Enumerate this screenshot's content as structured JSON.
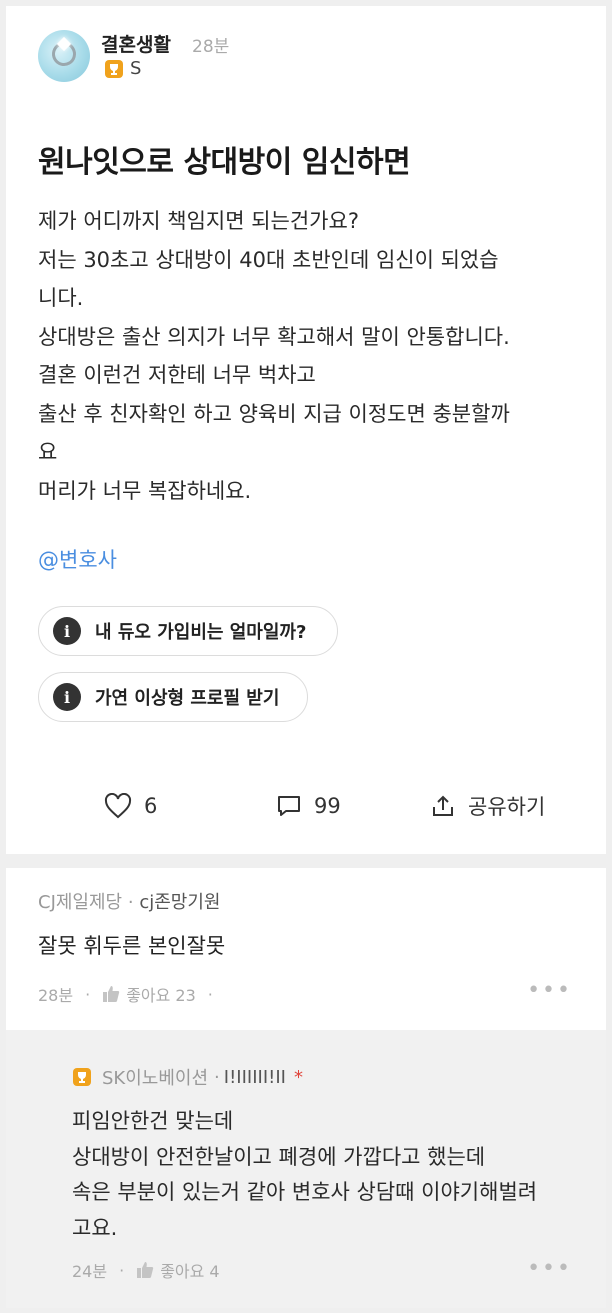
{
  "post": {
    "author": "결혼생활",
    "time": "28분",
    "grade": "S",
    "title": "원나잇으로 상대방이 임신하면",
    "body_lines": [
      "제가 어디까지 책임지면 되는건가요?",
      "저는 30초고 상대방이 40대 초반인데 임신이 되었습",
      "니다.",
      "상대방은 출산 의지가 너무 확고해서 말이 안통합니다.",
      "결혼 이런건 저한테 너무 벅차고",
      "출산 후 친자확인 하고 양육비 지급 이정도면 충분할까",
      "요",
      "머리가 너무 복잡하네요."
    ],
    "mention": "@변호사",
    "chips": [
      "내 듀오 가입비는 얼마일까?",
      "가연 이상형 프로필 받기"
    ],
    "info_glyph": "i",
    "likes": "6",
    "comments": "99",
    "share_label": "공유하기"
  },
  "comment": {
    "company": "CJ제일제당",
    "separator": "·",
    "nickname": "cj존망기원",
    "text": "잘못 휘두른 본인잘못",
    "time": "28분",
    "like_label": "좋아요 23",
    "more": "•••"
  },
  "reply": {
    "company": "SK이노베이션",
    "separator": "·",
    "nickname": "I!IIIIII!II",
    "author_mark": "*",
    "lines": [
      "피임안한건 맞는데",
      "상대방이 안전한날이고 폐경에 가깝다고 했는데",
      "속은 부분이 있는거 같아 변호사 상담때 이야기해벌려",
      "고요."
    ],
    "time": "24분",
    "like_label": "좋아요 4",
    "more": "•••"
  },
  "colors": {
    "accent_link": "#4a8ee0",
    "trophy": "#f0a21c",
    "author_mark": "#e0443a"
  },
  "icons": {
    "like": "heart-outline-icon",
    "comment": "speech-bubble-icon",
    "share": "share-upload-icon",
    "comment_like": "thumbs-up-icon",
    "badge": "trophy-icon",
    "chip": "info-icon",
    "more": "more-dots-icon"
  }
}
